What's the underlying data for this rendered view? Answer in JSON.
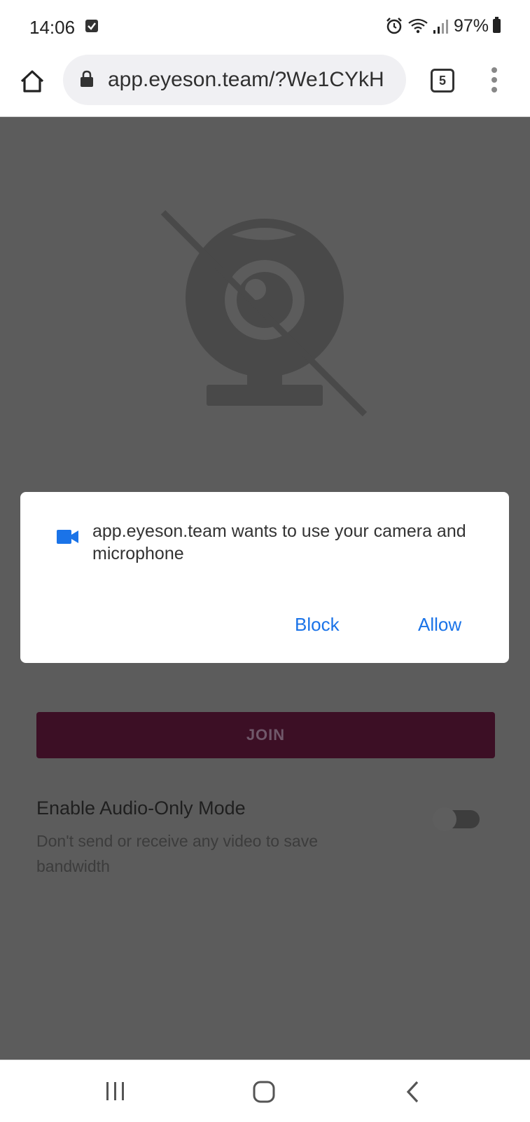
{
  "status_bar": {
    "time": "14:06",
    "battery": "97%",
    "icons": [
      "checkbox-icon",
      "alarm-icon",
      "wifi-icon",
      "signal-icon",
      "battery-icon"
    ]
  },
  "browser": {
    "url": "app.eyeson.team/?We1CYkH",
    "tab_count": "5",
    "icons": [
      "home-icon",
      "lock-icon",
      "overflow-menu-icon"
    ]
  },
  "illustration": {
    "icon": "camera-off-icon",
    "color": "#494949"
  },
  "dialog": {
    "message": "app.eyeson.team wants to use your camera and microphone",
    "block_label": "Block",
    "allow_label": "Allow",
    "icon": "videocam-icon",
    "accent_color": "#1a73e8"
  },
  "join": {
    "label": "JOIN",
    "color": "#3c0f25"
  },
  "audio_only": {
    "title": "Enable Audio-Only Mode",
    "description": "Don't send or receive any video to save bandwidth",
    "enabled": false
  },
  "nav": {
    "icons": [
      "recent-apps-icon",
      "home-nav-icon",
      "back-icon"
    ]
  }
}
